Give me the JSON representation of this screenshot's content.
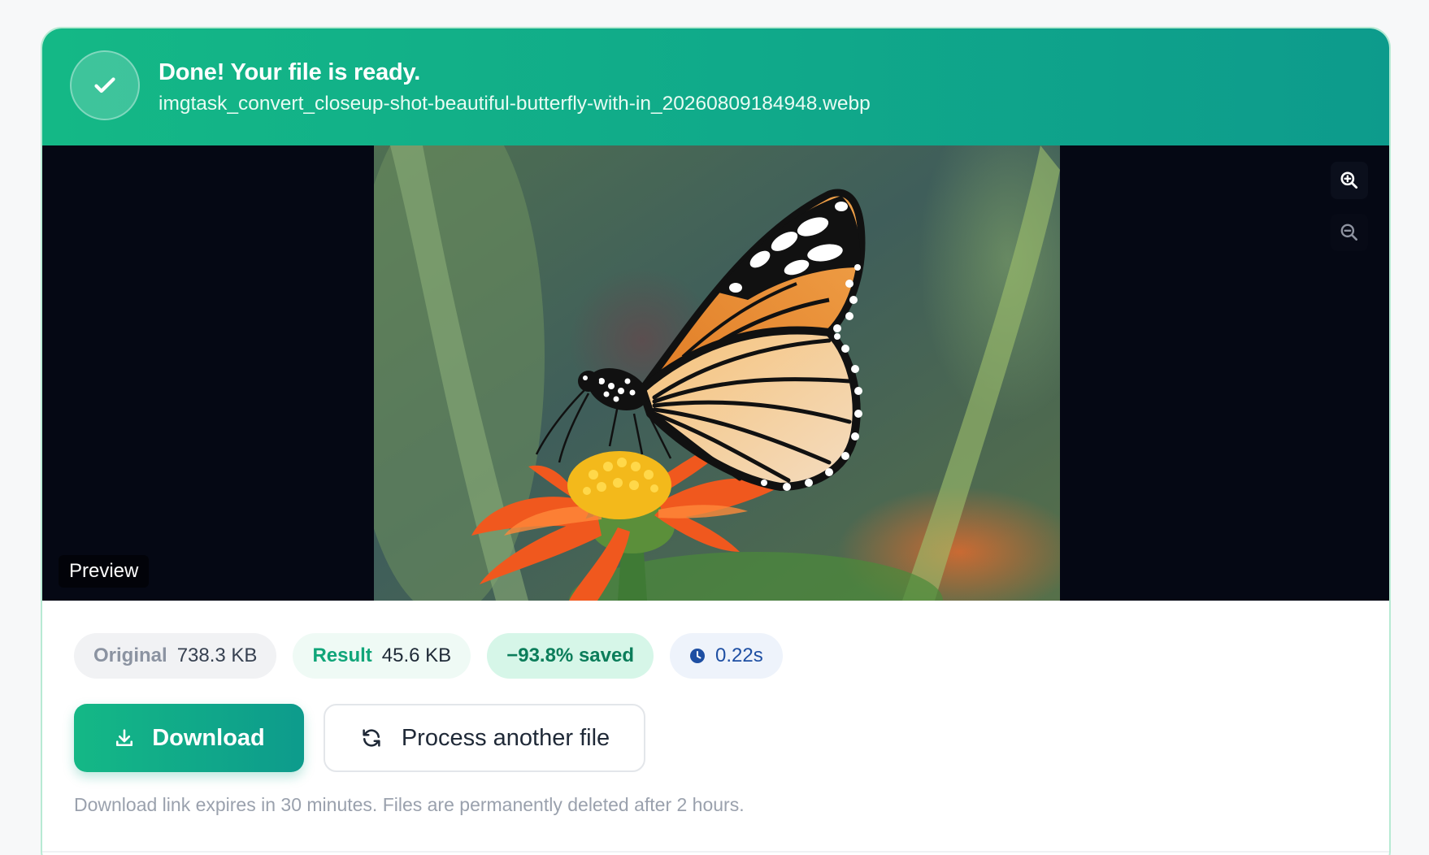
{
  "banner": {
    "title": "Done! Your file is ready.",
    "filename": "imgtask_convert_closeup-shot-beautiful-butterfly-with-in_20260809184948.webp",
    "icon": "check-icon"
  },
  "preview": {
    "label": "Preview",
    "zoom_in_icon": "zoom-in-icon",
    "zoom_out_icon": "zoom-out-icon"
  },
  "stats": {
    "original_label": "Original",
    "original_value": "738.3 KB",
    "result_label": "Result",
    "result_value": "45.6 KB",
    "saved": "−93.8% saved",
    "time": "0.22s",
    "time_icon": "clock-icon"
  },
  "actions": {
    "download_label": "Download",
    "download_icon": "download-icon",
    "process_label": "Process another file",
    "process_icon": "refresh-icon"
  },
  "note": "Download link expires in 30 minutes. Files are permanently deleted after 2 hours.",
  "colors": {
    "accent": "#14b886",
    "accent_dark": "#0d9b8c",
    "preview_bg": "#050814"
  }
}
